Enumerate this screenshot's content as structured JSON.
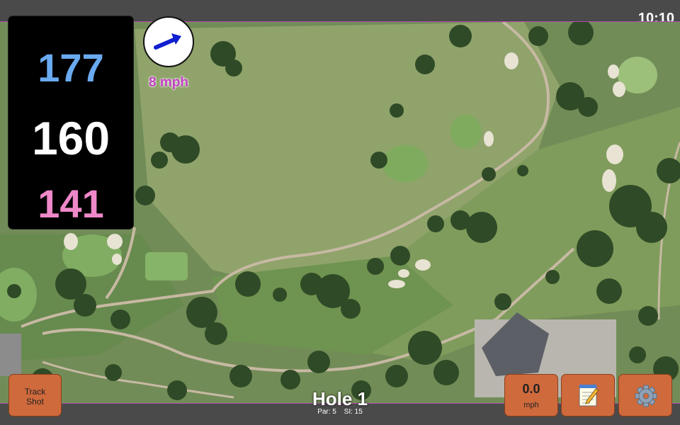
{
  "status_bar": {
    "time": "10:10"
  },
  "yardages": {
    "back": "177",
    "center": "160",
    "front": "141"
  },
  "colors": {
    "back": "#6aaaf0",
    "center": "#ffffff",
    "front": "#ee88c8",
    "wind_text": "#c040c0",
    "button": "#cf6a3c"
  },
  "wind": {
    "speed": "8 mph",
    "direction_icon": "wind-arrow-icon"
  },
  "buttons": {
    "track_shot": {
      "line1": "Track",
      "line2": "Shot"
    },
    "speed": {
      "value": "0.0",
      "unit": "mph"
    },
    "notes_icon": "notepad-icon",
    "settings_icon": "gear-icon"
  },
  "hole": {
    "title": "Hole 1",
    "par": "Par: 5",
    "stroke_index": "SI: 15"
  }
}
